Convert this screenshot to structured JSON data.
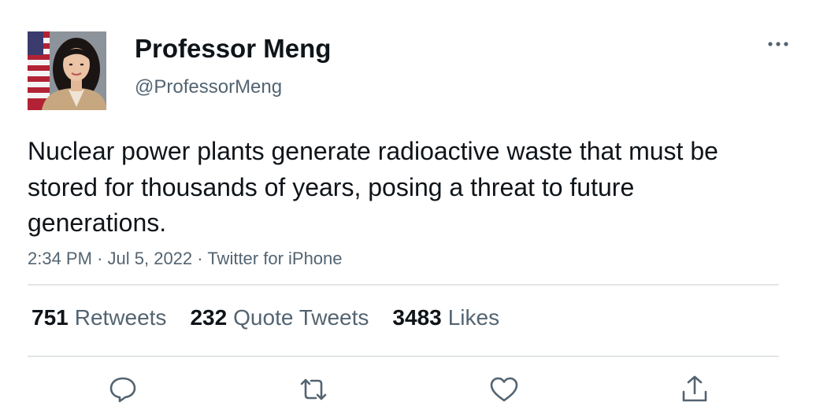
{
  "tweet": {
    "author": {
      "display_name": "Professor Meng",
      "handle": "@ProfessorMeng",
      "avatar_icon": "profile-photo"
    },
    "text": "Nuclear power plants generate radioactive waste that must be stored for thousands of years, posing a threat to future generations.",
    "meta": {
      "time": "2:34 PM",
      "separator": "·",
      "date": "Jul 5, 2022",
      "source": "Twitter for iPhone"
    },
    "stats": {
      "retweets": {
        "count": "751",
        "label": "Retweets"
      },
      "quote_tweets": {
        "count": "232",
        "label": "Quote Tweets"
      },
      "likes": {
        "count": "3483",
        "label": "Likes"
      }
    },
    "actions": [
      {
        "icon": "reply-icon"
      },
      {
        "icon": "retweet-icon"
      },
      {
        "icon": "like-icon"
      },
      {
        "icon": "share-icon"
      }
    ],
    "more_icon": "more-horizontal-icon"
  },
  "colors": {
    "text": "#0f1419",
    "secondary": "#536471",
    "divider": "#e3e6e8"
  }
}
